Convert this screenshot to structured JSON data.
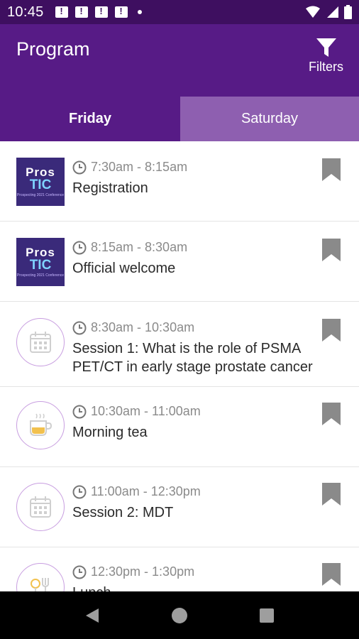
{
  "status_bar": {
    "time": "10:45",
    "notification_icons": [
      "notification-icon",
      "notification-icon",
      "notification-icon",
      "notification-icon"
    ],
    "right_icons": [
      "wifi-icon",
      "signal-icon",
      "battery-icon"
    ]
  },
  "app_bar": {
    "title": "Program",
    "filters_label": "Filters",
    "filters_icon": "funnel-icon"
  },
  "tabs": [
    {
      "label": "Friday",
      "active": true
    },
    {
      "label": "Saturday",
      "active": false
    }
  ],
  "logo_text": {
    "line1": "Pros",
    "line2": "TIC",
    "line3": "Prospecting 2021 Conference"
  },
  "items": [
    {
      "time": "7:30am - 8:15am",
      "title": "Registration",
      "thumb": "logo"
    },
    {
      "time": "8:15am - 8:30am",
      "title": "Official welcome",
      "thumb": "logo"
    },
    {
      "time": "8:30am - 10:30am",
      "title": "Session 1: What is the role of PSMA PET/CT in early stage prostate cancer",
      "thumb": "calendar-icon"
    },
    {
      "time": "10:30am - 11:00am",
      "title": "Morning tea",
      "thumb": "coffee-cup-icon"
    },
    {
      "time": "11:00am - 12:30pm",
      "title": "Session 2: MDT",
      "thumb": "calendar-icon"
    },
    {
      "time": "12:30pm - 1:30pm",
      "title": "Lunch",
      "thumb": "cutlery-icon"
    }
  ],
  "colors": {
    "status_bar": "#3e0f60",
    "primary": "#571b86",
    "tab_inactive": "#8e5fb0",
    "bookmark": "#8a8a8a"
  }
}
